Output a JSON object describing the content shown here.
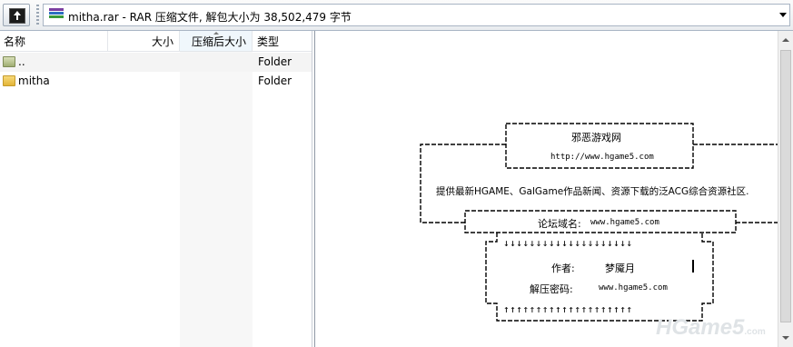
{
  "address_bar": {
    "path_text": "mitha.rar - RAR 压缩文件, 解包大小为 38,502,479 字节",
    "up_icon": "up-folder-icon",
    "archive_icon": "rar-archive-icon",
    "dropdown_icon": "chevron-down-icon"
  },
  "columns": {
    "name": "名称",
    "size": "大小",
    "packed": "压缩后大小",
    "type": "类型"
  },
  "files": [
    {
      "name": "..",
      "size": "",
      "packed": "",
      "type": "Folder",
      "icon": "parent-folder-icon"
    },
    {
      "name": "mitha",
      "size": "",
      "packed": "",
      "type": "Folder",
      "icon": "folder-icon"
    }
  ],
  "comment": {
    "site_name": "邪恶游戏网",
    "site_url": "http://www.hgame5.com",
    "slogan": "提供最新HGAME、GalGame作品新闻、资源下载的泛ACG综合资源社区.",
    "forum_label": "论坛域名:",
    "forum_url": "www.hgame5.com",
    "arrows_down": "↓↓↓↓↓↓↓↓↓↓↓↓↓↓↓↓↓↓↓↓",
    "arrows_up": "↑↑↑↑↑↑↑↑↑↑↑↑↑↑↑↑↑↑↑↑",
    "author_label": "作者:",
    "author_name": "梦魇月",
    "password_label": "解压密码:",
    "password_value": "www.hgame5.com",
    "watermark_main": "HGame5",
    "watermark_suffix": ".com"
  }
}
